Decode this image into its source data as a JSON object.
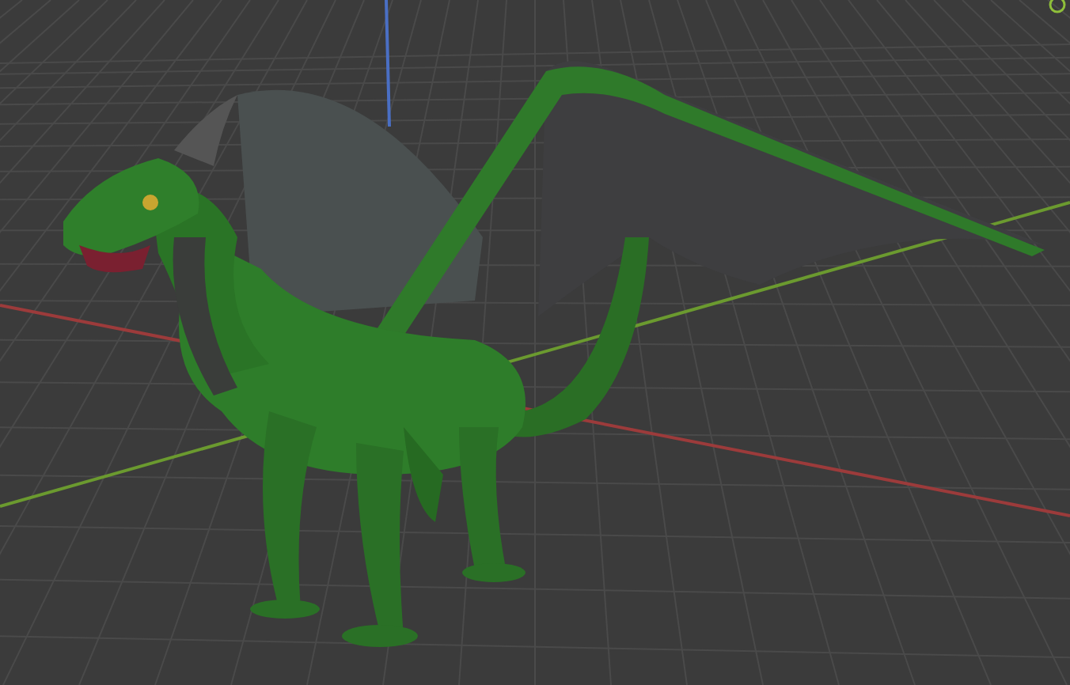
{
  "viewport": {
    "axes": [
      {
        "kind": "x",
        "color": "#9c3b3b"
      },
      {
        "kind": "y",
        "color": "#6b9a2f"
      },
      {
        "kind": "z",
        "color": "#4a6fc4"
      }
    ]
  }
}
